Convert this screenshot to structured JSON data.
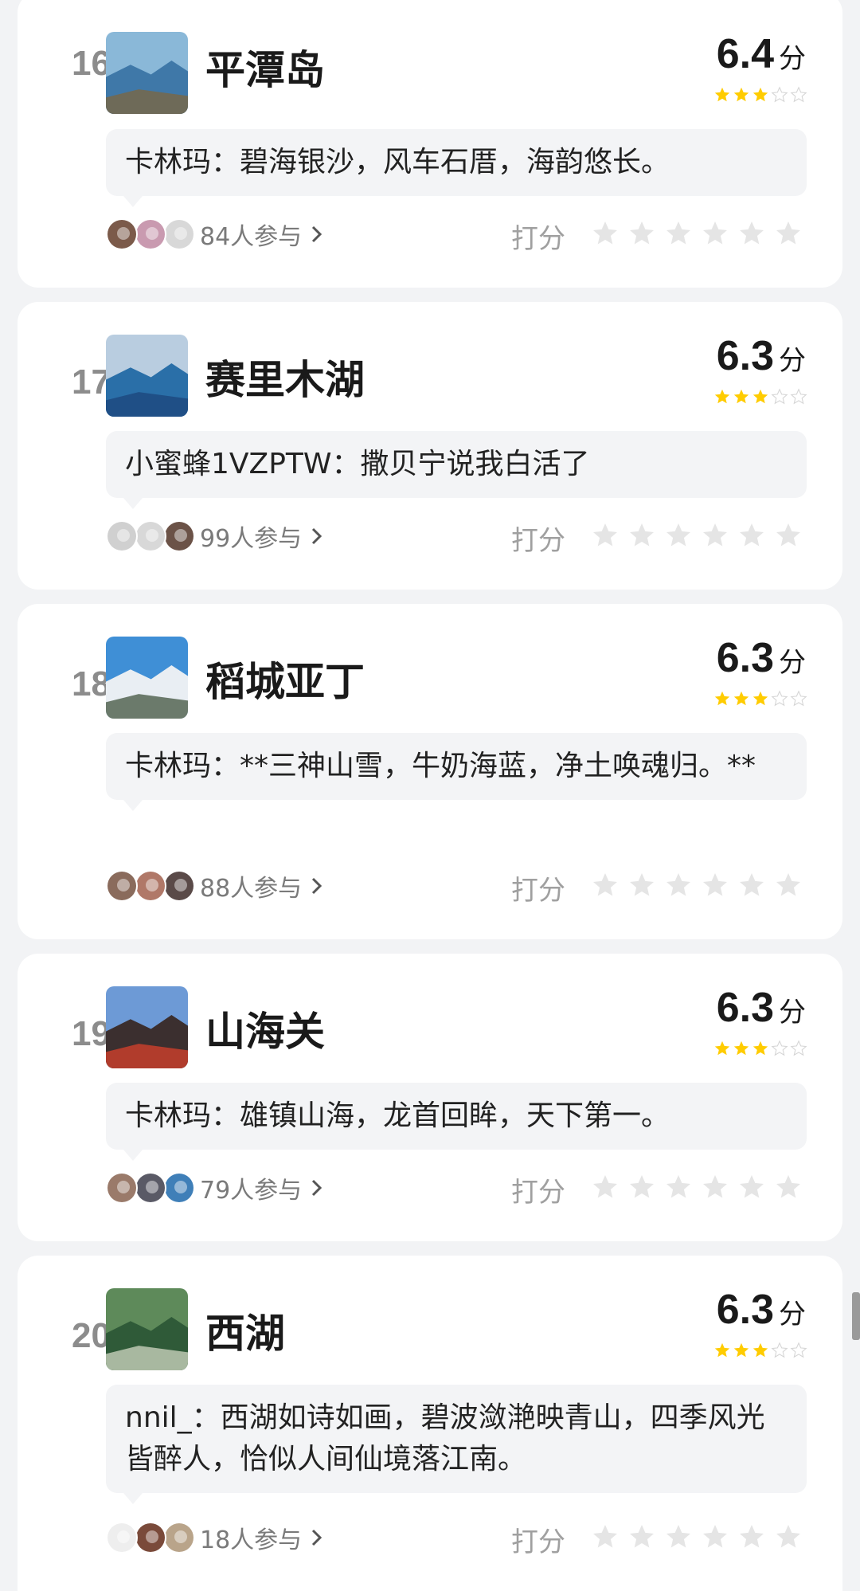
{
  "items": [
    {
      "rank": "16",
      "name": "平潭岛",
      "score": "6.4",
      "unit": "分",
      "stars_filled": 3,
      "stars_total": 5,
      "comment": "卡林玛：碧海银沙，风车石厝，海韵悠长。",
      "participants": "84人参与",
      "rate_label": "打分",
      "thumb_colors": [
        "#8ab8d8",
        "#3f78a8",
        "#6e6a58"
      ],
      "avatar_colors": [
        "#7b5a4a",
        "#c99ab0",
        "#d8d8d8"
      ]
    },
    {
      "rank": "17",
      "name": "赛里木湖",
      "score": "6.3",
      "unit": "分",
      "stars_filled": 3,
      "stars_total": 5,
      "comment": "小蜜蜂1VZPTW：撒贝宁说我白活了",
      "participants": "99人参与",
      "rate_label": "打分",
      "thumb_colors": [
        "#b9cde0",
        "#2a6fa8",
        "#1f4f86"
      ],
      "avatar_colors": [
        "#d0d0d0",
        "#d8d8d8",
        "#6b5247"
      ]
    },
    {
      "rank": "18",
      "name": "稻城亚丁",
      "score": "6.3",
      "unit": "分",
      "stars_filled": 3,
      "stars_total": 5,
      "comment": "卡林玛：**三神山雪，牛奶海蓝，净土唤魂归。**",
      "participants": "88人参与",
      "rate_label": "打分",
      "thumb_colors": [
        "#3f8fd6",
        "#e9eef3",
        "#6b7a6b"
      ],
      "avatar_colors": [
        "#8a6b5c",
        "#b07868",
        "#5a4a48"
      ]
    },
    {
      "rank": "19",
      "name": "山海关",
      "score": "6.3",
      "unit": "分",
      "stars_filled": 3,
      "stars_total": 5,
      "comment": "卡林玛：雄镇山海，龙首回眸，天下第一。",
      "participants": "79人参与",
      "rate_label": "打分",
      "thumb_colors": [
        "#6d9ad6",
        "#3b2f2f",
        "#b13c2c"
      ],
      "avatar_colors": [
        "#9a7a6a",
        "#5a5a66",
        "#3f7fb8"
      ]
    },
    {
      "rank": "20",
      "name": "西湖",
      "score": "6.3",
      "unit": "分",
      "stars_filled": 3,
      "stars_total": 5,
      "comment": "nnil_：西湖如诗如画，碧波潋滟映青山，四季风光皆醉人，恰似人间仙境落江南。",
      "participants": "18人参与",
      "rate_label": "打分",
      "thumb_colors": [
        "#5e8a5a",
        "#2f5a38",
        "#a8b8a0"
      ],
      "avatar_colors": [
        "#eeeeee",
        "#7a4a3a",
        "#b9a48a"
      ]
    }
  ],
  "colors": {
    "star_filled": "#ffcc00",
    "star_empty": "#d6d6d6",
    "rate_star": "#e5e5e5"
  }
}
